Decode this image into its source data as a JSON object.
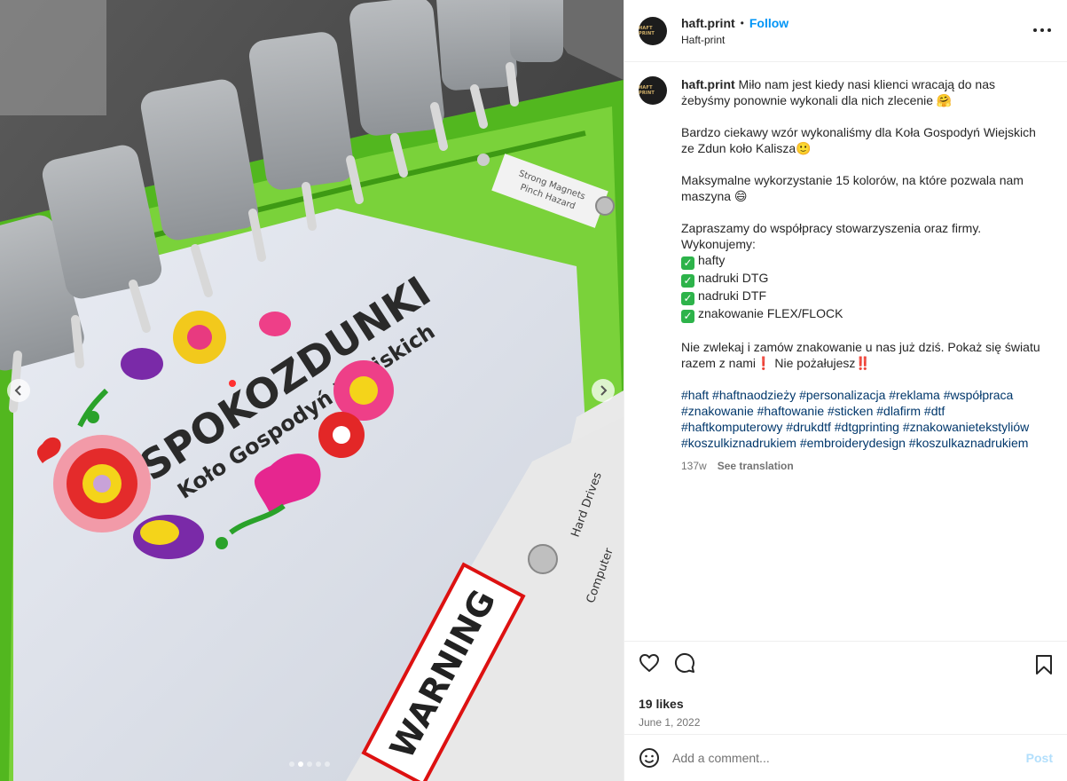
{
  "media": {
    "slide_count": 5,
    "active_slide": 2,
    "photo_text": {
      "main": "SPOKOZDUNKI",
      "sub": "Koło Gospodyń Wiejskich",
      "warning": "WARNING",
      "magnets": "Strong Magnets",
      "pinch": "Pinch Hazard",
      "drives": "Hard Drives",
      "computer": "Computer"
    }
  },
  "header": {
    "username": "haft.print",
    "separator": "•",
    "follow": "Follow",
    "subname": "Haft-print",
    "avatar_text": "HAFT PRINT"
  },
  "caption": {
    "username": "haft.print",
    "line1": "Miło nam jest kiedy nasi klienci wracają do nas żebyśmy ponownie wykonali dla nich zlecenie 🤗",
    "line2": "Bardzo ciekawy wzór wykonaliśmy dla Koła Gospodyń Wiejskich ze Zdun koło Kalisza🙂",
    "line3": "Maksymalne wykorzystanie 15 kolorów, na które pozwala nam maszyna 😄",
    "line4a": "Zapraszamy do współpracy stowarzyszenia oraz firmy.",
    "line4b": "Wykonujemy:",
    "services": [
      "hafty",
      "nadruki DTG",
      "nadruki DTF",
      "znakowanie FLEX/FLOCK"
    ],
    "check_glyph": "✓",
    "line5": "Nie zwlekaj i zamów znakowanie u nas już dziś. Pokaż się światu razem z nami❗ Nie pożałujesz‼️",
    "hashtags": "#haft #haftnaodzieży #personalizacja #reklama #współpraca #znakowanie #haftowanie #sticken #dlafirm #dtf #haftkomputerowy #drukdtf #dtgprinting #znakowanietekstyliów #koszulkiznadrukiem #embroiderydesign #koszulkaznadrukiem",
    "age": "137w",
    "see_translation": "See translation"
  },
  "actions": {
    "likes": "19 likes",
    "date": "June 1, 2022"
  },
  "comment": {
    "placeholder": "Add a comment...",
    "post": "Post"
  }
}
